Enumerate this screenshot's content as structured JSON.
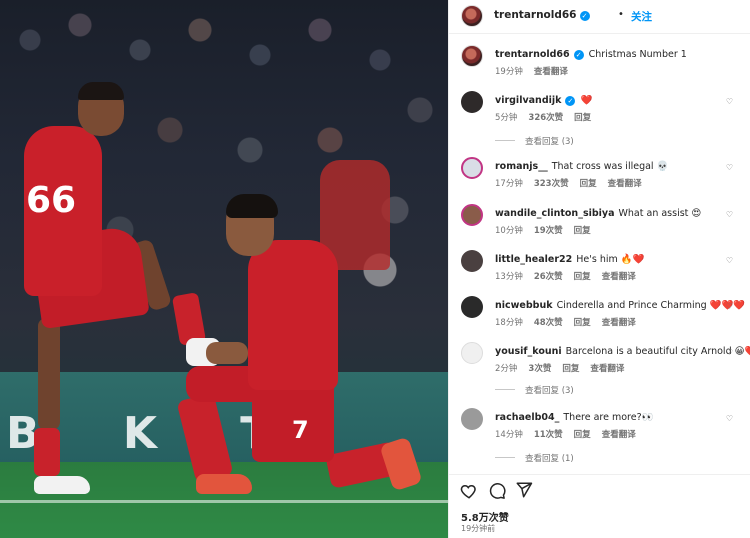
{
  "post": {
    "author": "trentarnold66",
    "separator": "•",
    "follow_label": "关注",
    "caption": {
      "user": "trentarnold66",
      "text": "Christmas Number 1",
      "time": "19分钟",
      "translate": "查看翻译"
    },
    "likes": "5.8万次赞",
    "posted_ago": "19分钟前"
  },
  "photo": {
    "ad_text": "B  K  T",
    "player1_number": "66",
    "player2_number": "7"
  },
  "comments": [
    {
      "user": "virgilvandijk",
      "text": "❤️",
      "time": "5分钟",
      "likes": "326次赞",
      "reply": "回复",
      "translate": "",
      "view_replies": "查看回复 (3)",
      "avatar_color": "#2e2a2a"
    },
    {
      "user": "romanjs__",
      "text": "That cross was illegal 💀",
      "time": "17分钟",
      "likes": "323次赞",
      "reply": "回复",
      "translate": "查看翻译",
      "view_replies": "",
      "avatar_color": "#d9dde6"
    },
    {
      "user": "wandile_clinton_sibiya",
      "text": "What an assist 😍",
      "time": "10分钟",
      "likes": "19次赞",
      "reply": "回复",
      "translate": "",
      "view_replies": "",
      "avatar_color": "#8a5c4a"
    },
    {
      "user": "little_healer22",
      "text": "He's him 🔥❤️",
      "time": "13分钟",
      "likes": "26次赞",
      "reply": "回复",
      "translate": "查看翻译",
      "view_replies": "",
      "avatar_color": "#4a4040"
    },
    {
      "user": "nicwebbuk",
      "text": "Cinderella and Prince Charming ❤️❤️❤️",
      "time": "18分钟",
      "likes": "48次赞",
      "reply": "回复",
      "translate": "查看翻译",
      "view_replies": "",
      "avatar_color": "#2a2a2a"
    },
    {
      "user": "yousif_kouni",
      "text": "Barcelona is a beautiful city Arnold 😀❤️💙",
      "time": "2分钟",
      "likes": "3次赞",
      "reply": "回复",
      "translate": "查看翻译",
      "view_replies": "查看回复 (3)",
      "avatar_color": "#f0f0f0"
    },
    {
      "user": "rachaelb04_",
      "text": "There are more?👀",
      "time": "14分钟",
      "likes": "11次赞",
      "reply": "回复",
      "translate": "查看翻译",
      "view_replies": "查看回复 (1)",
      "avatar_color": "#9a9a9a"
    }
  ],
  "icons": {
    "like": "heart-icon",
    "comment": "comment-icon",
    "share": "share-icon",
    "comment_like": "♡"
  },
  "colors": {
    "accent": "#0095f6",
    "muted": "#737373",
    "text": "#262626"
  }
}
